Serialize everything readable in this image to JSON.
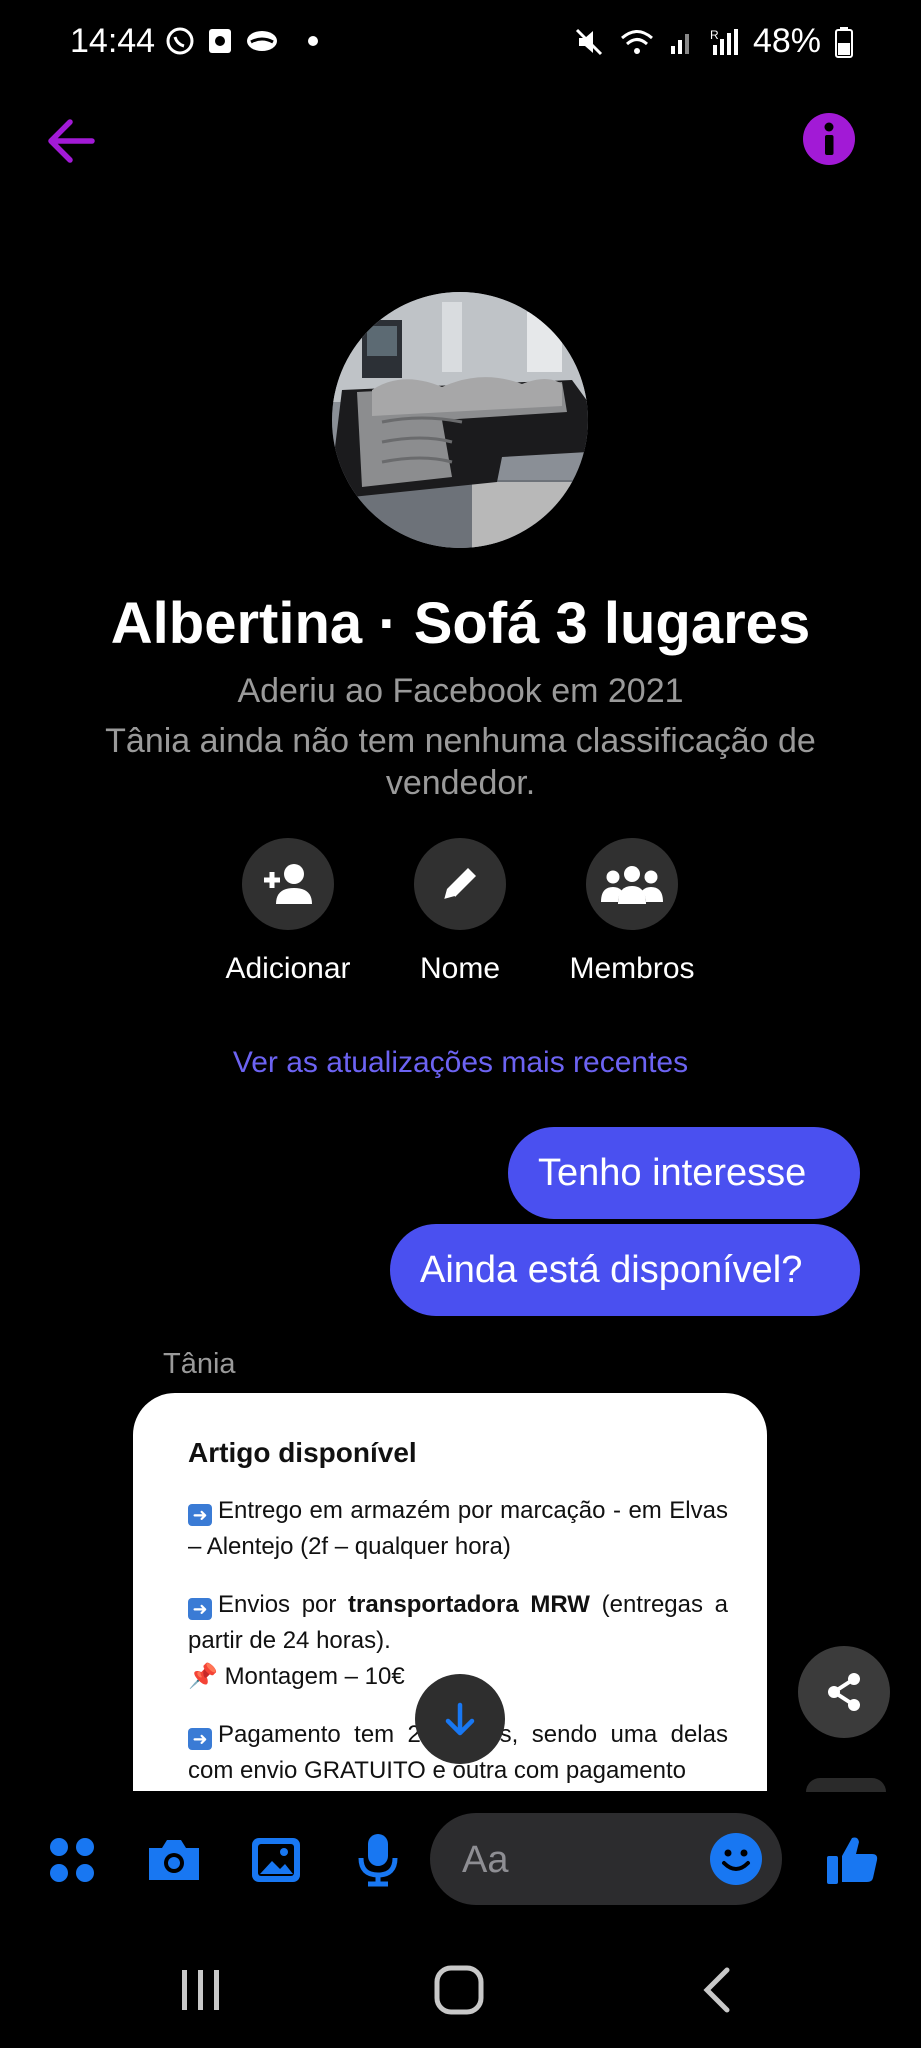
{
  "status_bar": {
    "time": "14:44",
    "battery": "48%",
    "icons": [
      "whatsapp-icon",
      "outlook-icon",
      "cloud-icon",
      "dot-icon",
      "mute-icon",
      "wifi-icon",
      "signal-icon",
      "signal-r-icon",
      "battery-icon"
    ]
  },
  "header": {
    "back_icon": "arrow-left-icon",
    "info_icon": "info-icon",
    "accent": "#a21ad6"
  },
  "conversation": {
    "title": "Albertina · Sofá 3 lugares",
    "joined": "Aderiu ao Facebook em 2021",
    "rating": "Tânia ainda não tem nenhuma classificação de vendedor."
  },
  "actions": [
    {
      "label": "Adicionar",
      "icon": "add-person-icon"
    },
    {
      "label": "Nome",
      "icon": "pencil-icon"
    },
    {
      "label": "Membros",
      "icon": "group-icon"
    }
  ],
  "recent_link": "Ver as atualizações mais recentes",
  "messages": {
    "outgoing": [
      "Tenho interesse",
      "Ainda está disponível?"
    ],
    "sender_name": "Tânia",
    "card": {
      "title": "Artigo disponível",
      "p1": "Entrego em armazém por marcação - em Elvas – Alentejo (2f – qualquer hora)",
      "p2_a": "Envios por ",
      "p2_bold": "transportadora MRW",
      "p2_b": " (entregas a partir de 24 horas).",
      "p3": "Montagem – 10€",
      "p4": "Pagamento tem 2 opções, sendo uma delas com envio GRATUITO e outra com pagamento"
    }
  },
  "composer": {
    "placeholder": "Aa",
    "icons": [
      "apps-icon",
      "camera-icon",
      "gallery-icon",
      "microphone-icon",
      "emoji-icon",
      "thumbs-up-icon"
    ],
    "accent": "#1877f2"
  },
  "colors": {
    "outgoing_bubble": "#4a50f0",
    "link": "#6c63f2"
  }
}
